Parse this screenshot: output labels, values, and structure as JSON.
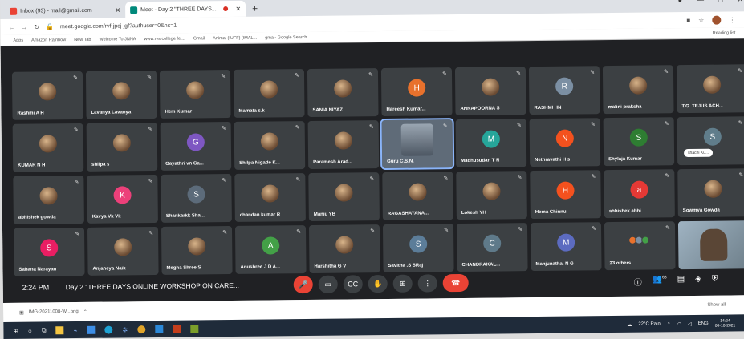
{
  "browser": {
    "tabs": [
      {
        "title": "Inbox (93) - mail@gmail.com",
        "active": false
      },
      {
        "title": "Meet - Day 2 \"THREE DAYS...",
        "active": true
      }
    ],
    "new_tab": "+",
    "url": "meet.google.com/rvf-jpcj-jgf?authuser=0&hs=1",
    "bookmarks": [
      "Apps",
      "Amazon Rainbow",
      "New Tab",
      "Welcome To JNNA",
      "www.rvs college fel...",
      "Gmail",
      "Animal (IUFF) (IMAL...",
      "gma - Google Search"
    ],
    "reading_list": "Reading list"
  },
  "participants": [
    {
      "name": "Rashmi A H",
      "avatar": "photo",
      "color": ""
    },
    {
      "name": "Lavanya Lavanya",
      "avatar": "photo",
      "color": ""
    },
    {
      "name": "Hem Kumar",
      "avatar": "photo",
      "color": ""
    },
    {
      "name": "Mamata s.k",
      "avatar": "photo",
      "color": ""
    },
    {
      "name": "SANIA NIYAZ",
      "avatar": "photo",
      "color": ""
    },
    {
      "name": "Hareesh Kumar...",
      "avatar": "H",
      "color": "#e8712c"
    },
    {
      "name": "ANNAPOORNA S",
      "avatar": "photo",
      "color": ""
    },
    {
      "name": "RASHMI HN",
      "avatar": "R",
      "color": "#7b8fa3"
    },
    {
      "name": "malini praksha",
      "avatar": "photo",
      "color": ""
    },
    {
      "name": "T.G. TEJUS ACH...",
      "avatar": "photo",
      "color": ""
    },
    {
      "name": "KUMAR N H",
      "avatar": "photo",
      "color": ""
    },
    {
      "name": "shilpa s",
      "avatar": "photo",
      "color": ""
    },
    {
      "name": "Gayathri vn Ga...",
      "avatar": "G",
      "color": "#7e57c2"
    },
    {
      "name": "Shilpa Nigade K...",
      "avatar": "photo",
      "color": ""
    },
    {
      "name": "Paramesh Arad...",
      "avatar": "photo",
      "color": ""
    },
    {
      "name": "Guru C.S.N.",
      "avatar": "speaker",
      "color": ""
    },
    {
      "name": "Madhusudan T R",
      "avatar": "M",
      "color": "#26a69a"
    },
    {
      "name": "Nethravathi H s",
      "avatar": "N",
      "color": "#f4511e"
    },
    {
      "name": "Shylaja Kumar",
      "avatar": "S",
      "color": "#2e7d32"
    },
    {
      "name": "",
      "avatar": "S",
      "color": "#607d8b",
      "pill": "shachi Ku..."
    },
    {
      "name": "abhishek gowda",
      "avatar": "photo",
      "color": ""
    },
    {
      "name": "Kavya Vk Vk",
      "avatar": "K",
      "color": "#ec407a"
    },
    {
      "name": "Shankarkk Sha...",
      "avatar": "S",
      "color": "#5c6b7a"
    },
    {
      "name": "chandan kumar R",
      "avatar": "photo",
      "color": ""
    },
    {
      "name": "Manju YB",
      "avatar": "photo",
      "color": ""
    },
    {
      "name": "RAGASHAYANA...",
      "avatar": "photo",
      "color": ""
    },
    {
      "name": "Lokesh YH",
      "avatar": "photo",
      "color": ""
    },
    {
      "name": "Hema Chinnu",
      "avatar": "H",
      "color": "#f4511e"
    },
    {
      "name": "abhishek abhi",
      "avatar": "a",
      "color": "#e53935"
    },
    {
      "name": "Sowmya Gowda",
      "avatar": "photo",
      "color": ""
    },
    {
      "name": "Sahana Narayan",
      "avatar": "S",
      "color": "#e91e63"
    },
    {
      "name": "Anjaneya Naik",
      "avatar": "photo",
      "color": ""
    },
    {
      "name": "Megha Shree S",
      "avatar": "photo",
      "color": ""
    },
    {
      "name": "Anushree J D A...",
      "avatar": "A",
      "color": "#43a047"
    },
    {
      "name": "Harshitha G V",
      "avatar": "photo",
      "color": ""
    },
    {
      "name": "Savitha .S SRaj",
      "avatar": "S",
      "color": "#5c7d99"
    },
    {
      "name": "CHANDRAKAL...",
      "avatar": "C",
      "color": "#5f7a8a"
    },
    {
      "name": "Manjunatha. N G",
      "avatar": "M",
      "color": "#5c6bc0"
    },
    {
      "name": "23 others",
      "avatar": "others",
      "color": ""
    },
    {
      "name": "",
      "avatar": "camera",
      "color": ""
    }
  ],
  "meeting": {
    "time": "2:24 PM",
    "title": "Day 2 \"THREE DAYS ONLINE WORKSHOP ON CARE...",
    "participant_badge": "63"
  },
  "download": {
    "file": "IMG-20211008-W...png",
    "show_all": "Show all"
  },
  "taskbar": {
    "weather": "22°C Rain",
    "lang": "ENG",
    "time": "14:24",
    "date": "08-10-2021"
  }
}
